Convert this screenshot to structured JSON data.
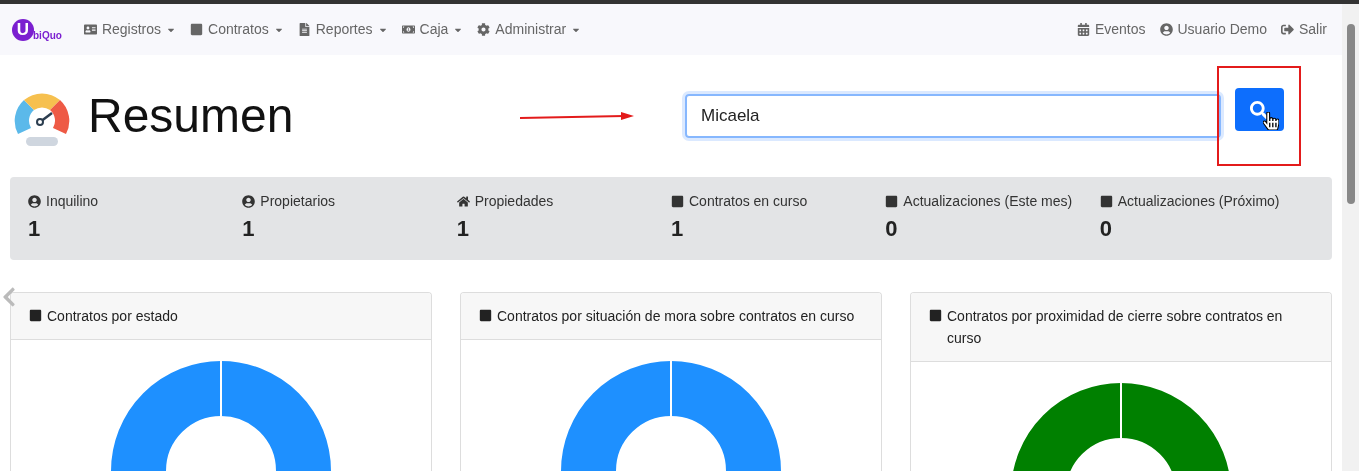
{
  "logo": {
    "initial": "U",
    "rest": "biQuo"
  },
  "nav": {
    "left": [
      {
        "label": "Registros",
        "kind": "contact"
      },
      {
        "label": "Contratos",
        "kind": "square"
      },
      {
        "label": "Reportes",
        "kind": "file"
      },
      {
        "label": "Caja",
        "kind": "money"
      },
      {
        "label": "Administrar",
        "kind": "gear"
      }
    ],
    "right": [
      {
        "label": "Eventos",
        "kind": "calendar"
      },
      {
        "label": "Usuario Demo",
        "kind": "user"
      },
      {
        "label": "Salir",
        "kind": "logout"
      }
    ]
  },
  "page_title": "Resumen",
  "search": {
    "value": "Micaela"
  },
  "stats": [
    {
      "label": "Inquilino",
      "kind": "user",
      "value": "1"
    },
    {
      "label": "Propietarios",
      "kind": "user",
      "value": "1"
    },
    {
      "label": "Propiedades",
      "kind": "home",
      "value": "1"
    },
    {
      "label": "Contratos en curso",
      "kind": "square",
      "value": "1"
    },
    {
      "label": "Actualizaciones (Este mes)",
      "kind": "square",
      "value": "0"
    },
    {
      "label": "Actualizaciones (Próximo)",
      "kind": "square",
      "value": "0"
    }
  ],
  "charts": [
    {
      "title": "Contratos por estado",
      "color": "#1e90ff"
    },
    {
      "title": "Contratos por situación de mora sobre contratos en curso",
      "color": "#1e90ff"
    },
    {
      "title": "Contratos por proximidad de cierre sobre contratos en curso",
      "color": "#008000"
    }
  ]
}
